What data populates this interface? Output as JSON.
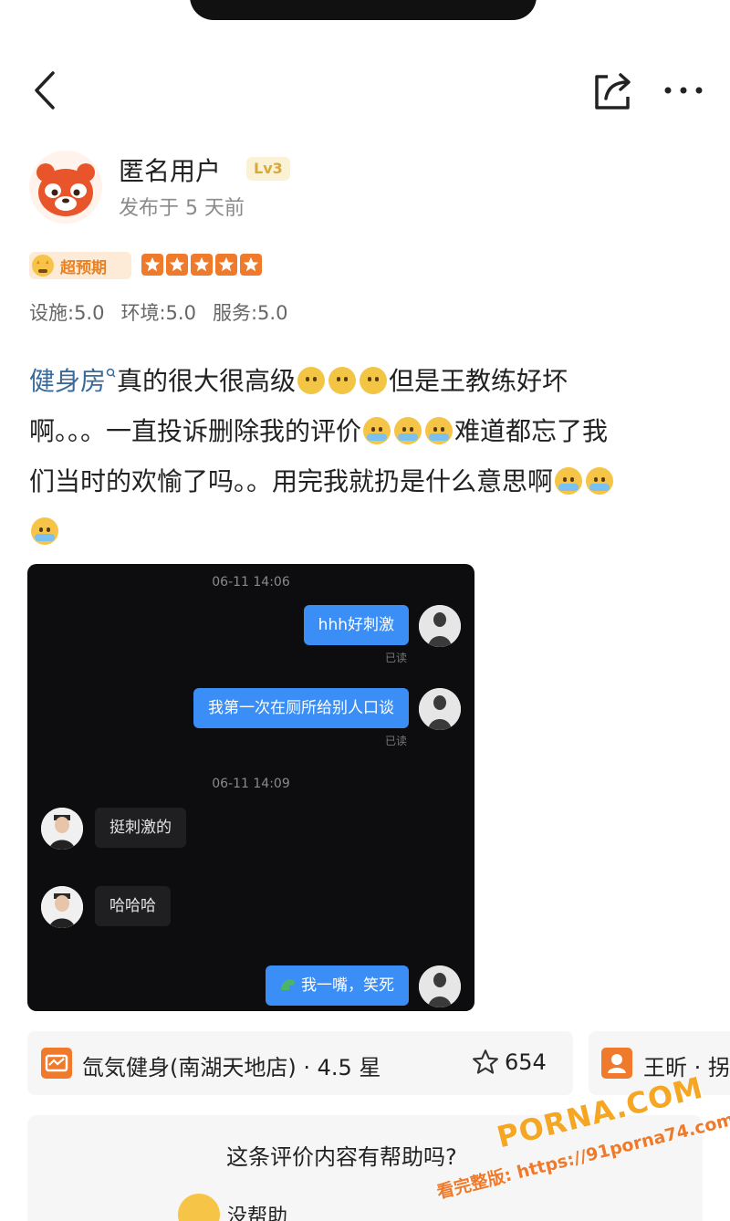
{
  "review": {
    "user_name": "匿名用户",
    "level": "Lv3",
    "posted_time": "发布于 5 天前",
    "badge": "超预期",
    "scores": [
      "设施:5.0",
      "环境:5.0",
      "服务:5.0"
    ],
    "tag": "健身房",
    "lines": {
      "part1": "真的很大很高级",
      "part2": "但是王教练好坏",
      "part3": "啊。。。一直投诉删除我的评价",
      "part4": "难道都忘了我",
      "part5": "们当时的欢愉了吗。。用完我就扔是什么意思啊"
    }
  },
  "chat": {
    "time1": "06-11 14:06",
    "msg1": "hhh好刺激",
    "read1": "已读",
    "msg2": "我第一次在厕所给别人口谈",
    "read2": "已读",
    "time2": "06-11 14:09",
    "msg3": "挺刺激的",
    "msg4": "哈哈哈",
    "msg5": "我一嘴，笑死"
  },
  "shop": {
    "name": "氙気健身(南湖天地店) · 4.5 星",
    "fav_count": "654",
    "person": "王昕 · 拐"
  },
  "helpful": {
    "question": "这条评价内容有帮助吗?",
    "no_label": "没帮助"
  },
  "watermark": {
    "big": "PORNA.COM",
    "small": "看完整版: https://91porna74.com"
  },
  "colors": {
    "accent": "#f07a2b",
    "tag_link": "#3b6a9a",
    "chat_bg": "#0d0d0f",
    "chat_me": "#3b8ef5"
  }
}
